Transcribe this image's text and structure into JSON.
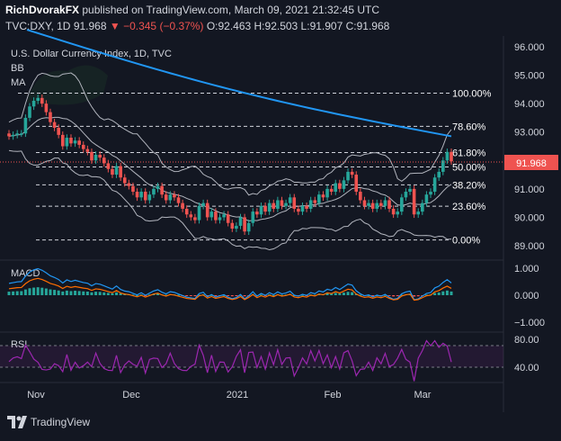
{
  "header": {
    "author": "RichDvorakFX",
    "published_text": "published on TradingView.com, March 09, 2021 21:32:45 UTC",
    "symbol": "TVC:DXY, 1D",
    "last": "91.968",
    "change": "▼ −0.345 (−0.37%)",
    "ohlc": "O:92.463 H:92.503 L:91.907 C:91.968"
  },
  "main_panel": {
    "title": "U.S. Dollar Currency Index, 1D, TVC",
    "indicator_bb": "BB",
    "indicator_ma": "MA",
    "price_badge": "91.968"
  },
  "price_axis": [
    "96.000",
    "95.000",
    "94.000",
    "93.000",
    "92.000",
    "91.000",
    "90.000",
    "89.000"
  ],
  "fib_levels": [
    {
      "label": "100.00%",
      "value": 94.37
    },
    {
      "label": "78.60%",
      "value": 93.2
    },
    {
      "label": "61.80%",
      "value": 92.28
    },
    {
      "label": "50.00%",
      "value": 91.77
    },
    {
      "label": "38.20%",
      "value": 91.14
    },
    {
      "label": "23.60%",
      "value": 90.39
    },
    {
      "label": "0.00%",
      "value": 89.2
    }
  ],
  "macd_panel": {
    "label": "MACD",
    "axis": [
      "1.000",
      "0.000",
      "−1.000"
    ]
  },
  "rsi_panel": {
    "label": "RSI",
    "axis": [
      "80.00",
      "40.00"
    ]
  },
  "time_axis": [
    "Nov",
    "Dec",
    "2021",
    "Feb",
    "Mar"
  ],
  "footer": {
    "brand": "TradingView"
  },
  "colors": {
    "background": "#131722",
    "up": "#26a69a",
    "down": "#ef5350",
    "ma": "#2196f3",
    "bb": "#b2b5be",
    "macd_line": "#2196f3",
    "signal_line": "#ff6d00",
    "rsi_line": "#9c27b0"
  }
}
